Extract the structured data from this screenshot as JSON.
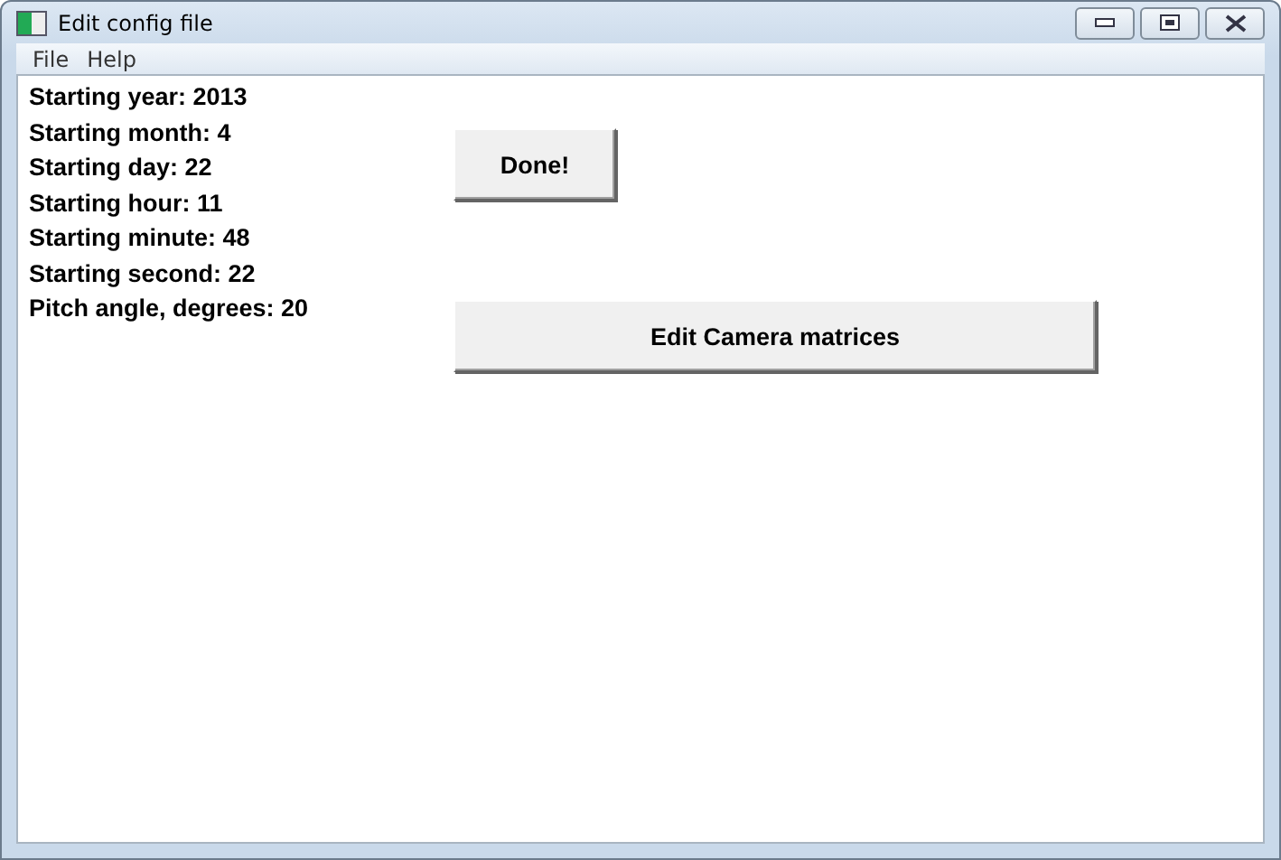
{
  "window": {
    "title": "Edit config file"
  },
  "menu": [
    "File",
    "Help"
  ],
  "fields": [
    {
      "label": "Starting year: 2013"
    },
    {
      "label": "Starting month: 4"
    },
    {
      "label": "Starting day: 22"
    },
    {
      "label": "Starting hour: 11"
    },
    {
      "label": "Starting minute: 48"
    },
    {
      "label": "Starting second: 22"
    },
    {
      "label": "Pitch angle, degrees: 20"
    }
  ],
  "buttons": [
    {
      "label": "Done!",
      "kind": "small"
    },
    {
      "label": "Edit Camera matrices",
      "kind": "wide"
    }
  ]
}
